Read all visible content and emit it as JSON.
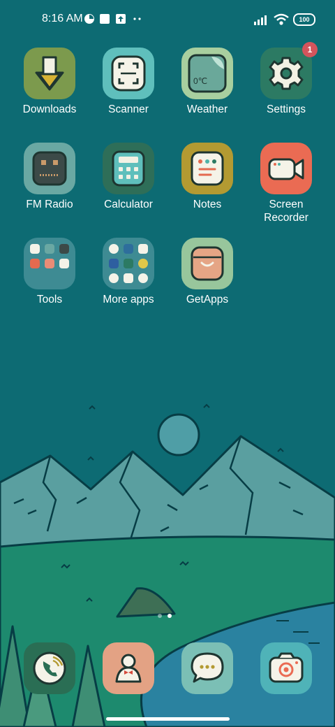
{
  "status_bar": {
    "time": "8:16 AM",
    "battery": "100",
    "icons": [
      "theme-icon",
      "square-notification-icon",
      "upload-notification-icon",
      "more-notifications-icon",
      "signal-icon",
      "wifi-icon",
      "battery-icon"
    ]
  },
  "apps": [
    {
      "label": "Downloads",
      "icon": "download-arrow-icon",
      "color": "#7c9a4d"
    },
    {
      "label": "Scanner",
      "icon": "scan-frame-icon",
      "color": "#5fbfbc"
    },
    {
      "label": "Weather",
      "icon": "weather-icon",
      "color": "#a8cf9f",
      "icon_text": "0℃"
    },
    {
      "label": "Settings",
      "icon": "gear-icon",
      "color": "#2c7a63",
      "badge": "1"
    },
    {
      "label": "FM Radio",
      "icon": "radio-icon",
      "color": "#6aa8a3"
    },
    {
      "label": "Calculator",
      "icon": "calculator-icon",
      "color": "#2e6e58"
    },
    {
      "label": "Notes",
      "icon": "notes-icon",
      "color": "#b39a32"
    },
    {
      "label": "Screen\nRecorder",
      "icon": "video-camera-icon",
      "color": "#ea6b53"
    },
    {
      "label": "Tools",
      "icon": "tools-folder-icon",
      "color": "#5a9fa7"
    },
    {
      "label": "More apps",
      "icon": "more-apps-folder-icon",
      "color": "#5a9fa7"
    },
    {
      "label": "GetApps",
      "icon": "shopping-bag-icon",
      "color": "#98c69c"
    }
  ],
  "page_indicator": {
    "pages": 2,
    "current": 2
  },
  "dock": [
    {
      "name": "phone",
      "icon": "phone-icon",
      "color": "#2a6e54"
    },
    {
      "name": "contacts",
      "icon": "contact-person-icon",
      "color": "#e3a284"
    },
    {
      "name": "messages",
      "icon": "chat-bubble-icon",
      "color": "#7bbfb5"
    },
    {
      "name": "camera",
      "icon": "camera-icon",
      "color": "#4fb3b8"
    }
  ]
}
